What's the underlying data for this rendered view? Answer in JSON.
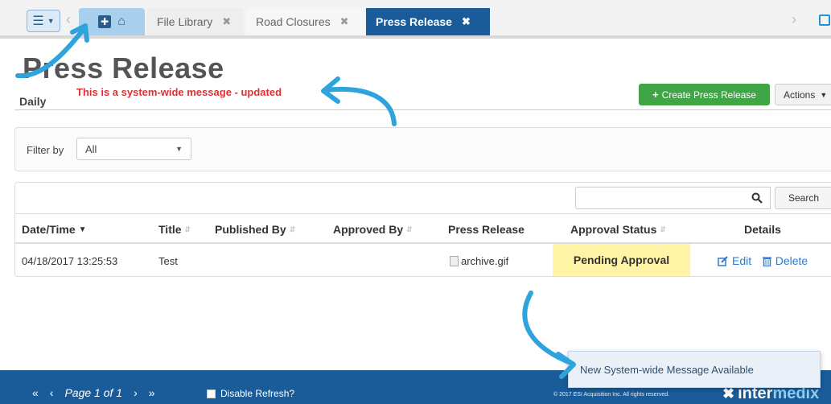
{
  "tabs": {
    "items": [
      {
        "label": "File Library"
      },
      {
        "label": "Road Closures"
      },
      {
        "label": "Press Release"
      }
    ],
    "close_glyph": "✖",
    "prev_glyph": "‹",
    "next_glyph": "›"
  },
  "header": {
    "title": "Press Release",
    "subtitle": "Daily",
    "system_message": "This is a system-wide message - updated",
    "create_label": "Create Press Release",
    "actions_label": "Actions"
  },
  "filter": {
    "label": "Filter by",
    "selected": "All"
  },
  "search": {
    "button_label": "Search",
    "value": ""
  },
  "table": {
    "columns": [
      "Date/Time",
      "Title",
      "Published By",
      "Approved By",
      "Press Release",
      "Approval Status",
      "Details"
    ],
    "rows": [
      {
        "datetime": "04/18/2017 13:25:53",
        "title": "Test",
        "published_by": "",
        "approved_by": "",
        "file": "archive.gif",
        "status": "Pending Approval",
        "edit_label": "Edit",
        "delete_label": "Delete"
      }
    ]
  },
  "toast": {
    "message": "New System-wide Message Available"
  },
  "footer": {
    "page_label": "Page 1 of 1",
    "refresh_label": "Disable Refresh?",
    "copyright": "© 2017 ESI Acquisition Inc. All rights reserved.",
    "logo_part1": "inter",
    "logo_part2": "medix"
  },
  "colors": {
    "brand_blue": "#1a5c99",
    "create_green": "#3fa547",
    "message_red": "#e03131",
    "pending_yellow": "#fff3a6",
    "annotation_arrow": "#2fa4dc"
  }
}
